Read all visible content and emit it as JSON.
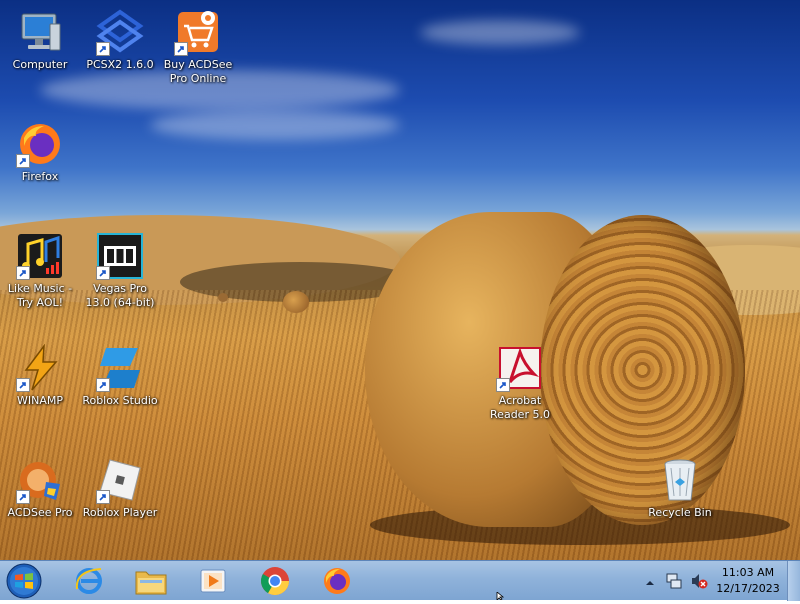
{
  "desktop": {
    "icons": [
      {
        "name": "Computer",
        "label": "Computer",
        "icon": "computer-icon"
      },
      {
        "name": "PCSX2",
        "label": "PCSX2 1.6.0",
        "icon": "pcsx2-icon"
      },
      {
        "name": "Buy ACDSee",
        "label": "Buy ACDSee Pro Online",
        "icon": "shopping-cart-icon"
      },
      {
        "name": "Firefox",
        "label": "Firefox",
        "icon": "firefox-icon"
      },
      {
        "name": "Like Music",
        "label": "Like Music - Try AOL!",
        "icon": "music-notes-icon"
      },
      {
        "name": "Vegas Pro",
        "label": "Vegas Pro 13.0 (64-bit)",
        "icon": "film-icon"
      },
      {
        "name": "WINAMP",
        "label": "WINAMP",
        "icon": "winamp-icon"
      },
      {
        "name": "Roblox Studio",
        "label": "Roblox Studio",
        "icon": "roblox-studio-icon"
      },
      {
        "name": "Acrobat Reader",
        "label": "Acrobat Reader 5.0",
        "icon": "acrobat-icon"
      },
      {
        "name": "ACDSee Pro",
        "label": "ACDSee Pro",
        "icon": "acdsee-icon"
      },
      {
        "name": "Roblox Player",
        "label": "Roblox Player",
        "icon": "roblox-player-icon"
      },
      {
        "name": "Recycle Bin",
        "label": "Recycle Bin",
        "icon": "recycle-bin-icon"
      }
    ]
  },
  "taskbar": {
    "start": "start-orb-icon",
    "pinned": [
      "internet-explorer-icon",
      "file-explorer-icon",
      "media-player-icon",
      "chrome-icon",
      "firefox-icon"
    ],
    "tray": {
      "icons": [
        "show-hidden-icons-arrow",
        "network-icon",
        "volume-muted-icon"
      ],
      "time": "11:03 AM",
      "date": "12/17/2023"
    }
  },
  "colors": {
    "taskbar": "#8fb2da",
    "sky": "#1d4cb0",
    "field": "#c98737"
  }
}
